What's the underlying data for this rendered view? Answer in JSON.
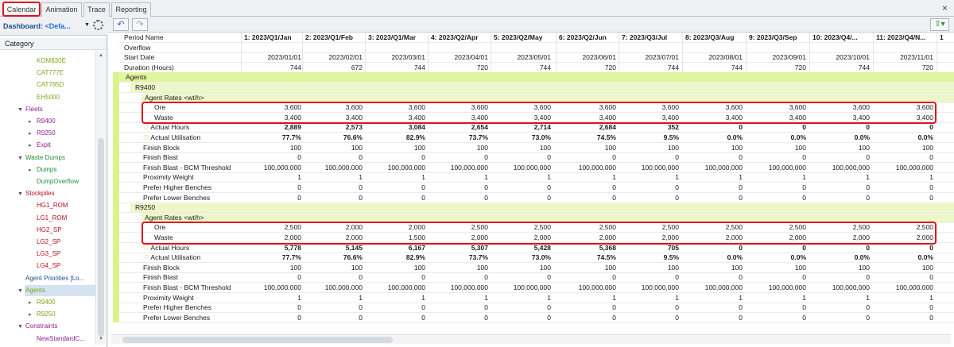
{
  "tabs": [
    {
      "label": "Calendar",
      "active": true
    },
    {
      "label": "Animation",
      "active": false
    },
    {
      "label": "Trace",
      "active": false
    },
    {
      "label": "Reporting",
      "active": false
    }
  ],
  "close_label": "×",
  "dashboard": {
    "label": "Dashboard: ",
    "value": "<Defa..."
  },
  "category_header": "Category",
  "tree": [
    {
      "label": "KOM830E",
      "color": "#7aa51a",
      "depth": 2,
      "toggle": ""
    },
    {
      "label": "CAT777E",
      "color": "#7aa51a",
      "depth": 2,
      "toggle": ""
    },
    {
      "label": "CAT785D",
      "color": "#7aa51a",
      "depth": 2,
      "toggle": ""
    },
    {
      "label": "EH5000",
      "color": "#7aa51a",
      "depth": 2,
      "toggle": ""
    },
    {
      "label": "Fleets",
      "color": "#8b1f8b",
      "depth": 1,
      "toggle": "▼"
    },
    {
      "label": "R9400",
      "color": "#8b1f8b",
      "depth": 2,
      "toggle": "▸"
    },
    {
      "label": "R9250",
      "color": "#8b1f8b",
      "depth": 2,
      "toggle": "▸"
    },
    {
      "label": "Expit",
      "color": "#8b1f8b",
      "depth": 2,
      "toggle": "▸"
    },
    {
      "label": "Waste Dumps",
      "color": "#1f8f3a",
      "depth": 1,
      "toggle": "▼"
    },
    {
      "label": "Dumps",
      "color": "#1f8f3a",
      "depth": 2,
      "toggle": "▸"
    },
    {
      "label": "DumpOverflow",
      "color": "#1f8f3a",
      "depth": 2,
      "toggle": ""
    },
    {
      "label": "Stockpiles",
      "color": "#b0141c",
      "depth": 1,
      "toggle": "▼"
    },
    {
      "label": "HG1_ROM",
      "color": "#b0141c",
      "depth": 2,
      "toggle": ""
    },
    {
      "label": "LG1_ROM",
      "color": "#b0141c",
      "depth": 2,
      "toggle": ""
    },
    {
      "label": "HG2_SP",
      "color": "#b0141c",
      "depth": 2,
      "toggle": ""
    },
    {
      "label": "LG2_SP",
      "color": "#b0141c",
      "depth": 2,
      "toggle": ""
    },
    {
      "label": "LG3_SP",
      "color": "#b0141c",
      "depth": 2,
      "toggle": ""
    },
    {
      "label": "LG4_SP",
      "color": "#b0141c",
      "depth": 2,
      "toggle": ""
    },
    {
      "label": "Agent Priorities [Lo...",
      "color": "#1e4f8c",
      "depth": 1,
      "toggle": ""
    },
    {
      "label": "Agents",
      "color": "#7aa51a",
      "depth": 1,
      "toggle": "▼"
    },
    {
      "label": "R9400",
      "color": "#7aa51a",
      "depth": 2,
      "toggle": "▸"
    },
    {
      "label": "R9250",
      "color": "#7aa51a",
      "depth": 2,
      "toggle": "▸"
    },
    {
      "label": "Constraints",
      "color": "#8b1f8b",
      "depth": 1,
      "toggle": "▼"
    },
    {
      "label": "NewStandardC...",
      "color": "#8b1f8b",
      "depth": 2,
      "toggle": ""
    }
  ],
  "toolbar": {
    "undo_icon": "undo-icon",
    "redo_icon": "redo-icon",
    "export_icon": "export-icon"
  },
  "grid": {
    "header_rows": [
      {
        "label": "Period Name",
        "bold": true,
        "values": [
          "1: 2023/Q1/Jan",
          "2: 2023/Q1/Feb",
          "3: 2023/Q1/Mar",
          "4: 2023/Q2/Apr",
          "5: 2023/Q2/May",
          "6: 2023/Q2/Jun",
          "7: 2023/Q3/Jul",
          "8: 2023/Q3/Aug",
          "9: 2023/Q3/Sep",
          "10: 2023/Q4/...",
          "11: 2023/Q4/N...",
          "1"
        ]
      },
      {
        "label": "Overflow",
        "bold": false,
        "values": [
          "",
          "",
          "",
          "",
          "",
          "",
          "",
          "",
          "",
          "",
          "",
          ""
        ]
      },
      {
        "label": "Start Date",
        "bold": false,
        "values": [
          "2023/01/01",
          "2023/02/01",
          "2023/03/01",
          "2023/04/01",
          "2023/05/01",
          "2023/06/01",
          "2023/07/01",
          "2023/08/01",
          "2023/09/01",
          "2023/10/01",
          "2023/11/01",
          ""
        ]
      },
      {
        "label": "Duration (Hours)",
        "bold": false,
        "values": [
          "744",
          "672",
          "744",
          "720",
          "744",
          "720",
          "744",
          "744",
          "720",
          "744",
          "720",
          ""
        ]
      }
    ],
    "agents_label": "Agents",
    "agent_rates_label": "Agent Rates <wt/h>",
    "agents": [
      {
        "name": "R9400",
        "ore": [
          "3,600",
          "3,600",
          "3,600",
          "3,600",
          "3,600",
          "3,600",
          "3,600",
          "3,600",
          "3,600",
          "3,600",
          "3,600"
        ],
        "waste": [
          "3,400",
          "3,400",
          "3,400",
          "3,400",
          "3,400",
          "3,400",
          "3,400",
          "3,400",
          "3,400",
          "3,400",
          "3,400"
        ],
        "actual_hours": [
          "2,889",
          "2,573",
          "3,084",
          "2,654",
          "2,714",
          "2,684",
          "352",
          "0",
          "0",
          "0",
          "0"
        ],
        "actual_utilisation": [
          "77.7%",
          "76.6%",
          "82.9%",
          "73.7%",
          "73.0%",
          "74.5%",
          "9.5%",
          "0.0%",
          "0.0%",
          "0.0%",
          "0.0%"
        ],
        "finish_block": [
          "100",
          "100",
          "100",
          "100",
          "100",
          "100",
          "100",
          "100",
          "100",
          "100",
          "100"
        ],
        "finish_blast": [
          "0",
          "0",
          "0",
          "0",
          "0",
          "0",
          "0",
          "0",
          "0",
          "0",
          "0"
        ],
        "bcm_threshold": [
          "100,000,000",
          "100,000,000",
          "100,000,000",
          "100,000,000",
          "100,000,000",
          "100,000,000",
          "100,000,000",
          "100,000,000",
          "100,000,000",
          "100,000,000",
          "100,000,000"
        ],
        "proximity_weight": [
          "1",
          "1",
          "1",
          "1",
          "1",
          "1",
          "1",
          "1",
          "1",
          "1",
          "1"
        ],
        "prefer_higher": [
          "0",
          "0",
          "0",
          "0",
          "0",
          "0",
          "0",
          "0",
          "0",
          "0",
          "0"
        ],
        "prefer_lower": [
          "0",
          "0",
          "0",
          "0",
          "0",
          "0",
          "0",
          "0",
          "0",
          "0",
          "0"
        ]
      },
      {
        "name": "R9250",
        "ore": [
          "2,500",
          "2,000",
          "2,000",
          "2,500",
          "2,500",
          "2,500",
          "2,500",
          "2,500",
          "2,500",
          "2,500",
          "2,500"
        ],
        "waste": [
          "2,000",
          "2,000",
          "1,500",
          "2,000",
          "2,000",
          "2,000",
          "2,000",
          "2,000",
          "2,000",
          "2,000",
          "2,000"
        ],
        "actual_hours": [
          "5,778",
          "5,145",
          "6,167",
          "5,307",
          "5,428",
          "5,368",
          "705",
          "0",
          "0",
          "0",
          "0"
        ],
        "actual_utilisation": [
          "77.7%",
          "76.6%",
          "82.9%",
          "73.7%",
          "73.0%",
          "74.5%",
          "9.5%",
          "0.0%",
          "0.0%",
          "0.0%",
          "0.0%"
        ],
        "finish_block": [
          "100",
          "100",
          "100",
          "100",
          "100",
          "100",
          "100",
          "100",
          "100",
          "100",
          "100"
        ],
        "finish_blast": [
          "0",
          "0",
          "0",
          "0",
          "0",
          "0",
          "0",
          "0",
          "0",
          "0",
          "0"
        ],
        "bcm_threshold": [
          "100,000,000",
          "100,000,000",
          "100,000,000",
          "100,000,000",
          "100,000,000",
          "100,000,000",
          "100,000,000",
          "100,000,000",
          "100,000,000",
          "100,000,000",
          "100,000,000"
        ],
        "proximity_weight": [
          "1",
          "1",
          "1",
          "1",
          "1",
          "1",
          "1",
          "1",
          "1",
          "1",
          "1"
        ],
        "prefer_higher": [
          "0",
          "0",
          "0",
          "0",
          "0",
          "0",
          "0",
          "0",
          "0",
          "0",
          "0"
        ],
        "prefer_lower": [
          "0",
          "0",
          "0",
          "0",
          "0",
          "0",
          "0",
          "0",
          "0",
          "0",
          "0"
        ]
      }
    ],
    "row_labels": {
      "ore": "Ore",
      "waste": "Waste",
      "actual_hours": "Actual Hours",
      "actual_utilisation": "Actual Utilisation",
      "finish_block": "Finish Block",
      "finish_blast": "Finish Blast",
      "bcm_threshold": "Finish Blast - BCM Threshold",
      "proximity_weight": "Proximity Weight",
      "prefer_higher": "Prefer Higher Benches",
      "prefer_lower": "Prefer Lower Benches"
    }
  },
  "colors": {
    "highlight": "#e01020",
    "agents_band": "#e3f59c",
    "sub_band": "#eef7c9"
  }
}
